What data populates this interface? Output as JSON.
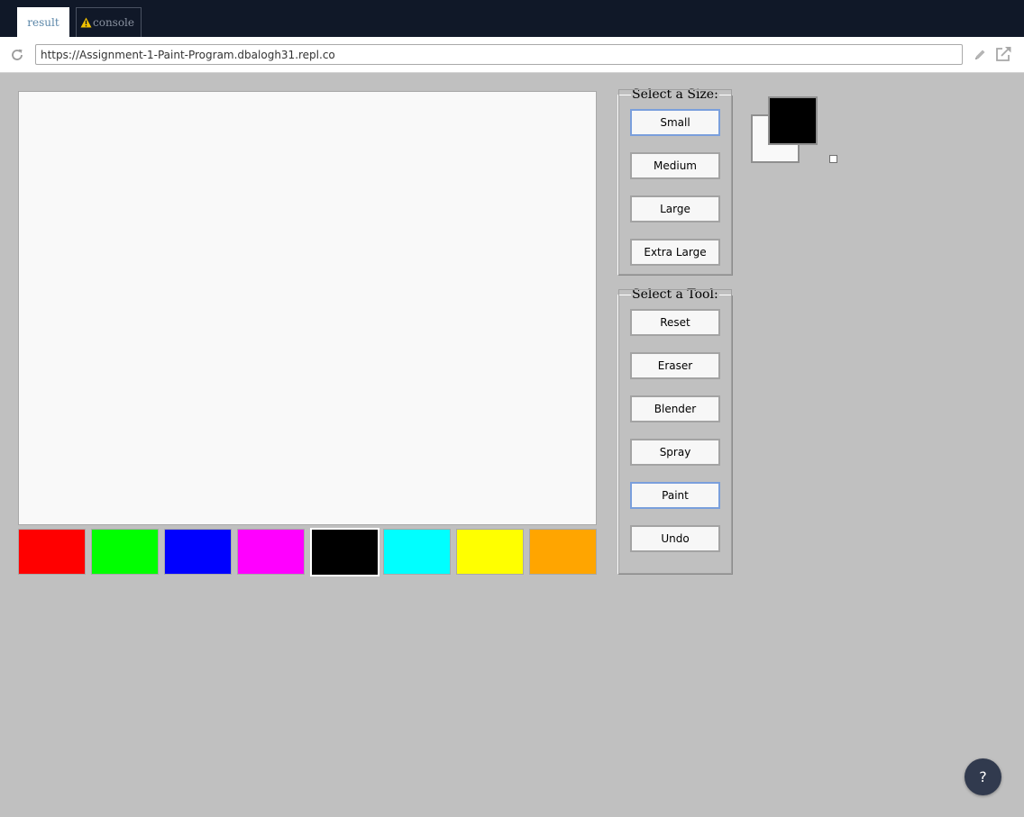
{
  "tabs": {
    "result": "result",
    "console": "console"
  },
  "urlbar": {
    "url": "https://Assignment-1-Paint-Program.dbalogh31.repl.co"
  },
  "palette": [
    {
      "name": "red",
      "color": "#ff0000"
    },
    {
      "name": "green",
      "color": "#00ff00"
    },
    {
      "name": "blue",
      "color": "#0000ff"
    },
    {
      "name": "magenta",
      "color": "#ff00ff"
    },
    {
      "name": "black",
      "color": "#000000",
      "selected": true
    },
    {
      "name": "cyan",
      "color": "#00ffff"
    },
    {
      "name": "yellow",
      "color": "#ffff00"
    },
    {
      "name": "orange",
      "color": "#ffa500"
    }
  ],
  "size_panel": {
    "legend": "Select a Size:",
    "buttons": [
      "Small",
      "Medium",
      "Large",
      "Extra Large"
    ],
    "active": "Small"
  },
  "tool_panel": {
    "legend": "Select a Tool:",
    "buttons": [
      "Reset",
      "Eraser",
      "Blender",
      "Spray",
      "Paint",
      "Undo"
    ],
    "active": "Paint"
  },
  "current_colors": {
    "primary": "#000000",
    "secondary": "#f9f9f9"
  },
  "help": {
    "label": "?"
  },
  "icons": {
    "reload": "reload-icon",
    "pencil": "pencil-icon",
    "external": "external-link-icon",
    "warning": "warning-icon"
  }
}
